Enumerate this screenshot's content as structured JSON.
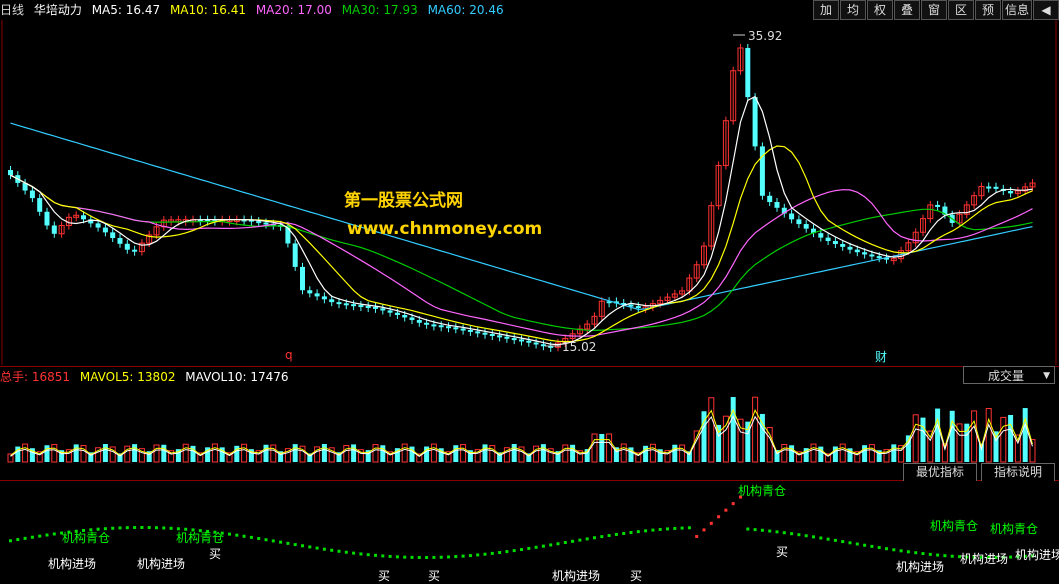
{
  "header": {
    "period": "日线",
    "stock_name": "华培动力",
    "ma_items": [
      {
        "label": "MA5: 16.47",
        "color": "#ffffff"
      },
      {
        "label": "MA10: 16.41",
        "color": "#ffff00"
      },
      {
        "label": "MA20: 17.00",
        "color": "#ff66ff"
      },
      {
        "label": "MA30: 17.93",
        "color": "#00cc00"
      },
      {
        "label": "MA60: 20.46",
        "color": "#33ccff"
      }
    ],
    "buttons": [
      "加",
      "均",
      "权",
      "叠",
      "窗",
      "区",
      "预",
      "信息",
      "◀"
    ]
  },
  "watermark": {
    "line1": "第一股票公式网",
    "line2": "www.chnmoney.com"
  },
  "price_labels": {
    "high": "35.92",
    "low": "15.02",
    "marker_q": "q",
    "marker_cai": "财"
  },
  "volume": {
    "title": "总手: 16851",
    "mavol5": "MAVOL5: 13802",
    "mavol10": "MAVOL10: 17476",
    "selector": "成交量"
  },
  "indicator": {
    "tabs": [
      "最优指标",
      "指标说明"
    ],
    "signals": [
      {
        "text": "机构青仓",
        "color": "#00ff00"
      },
      {
        "text": "机构进场",
        "color": "#ffffff"
      },
      {
        "text": "机构青仓",
        "color": "#00ff00"
      },
      {
        "text": "机构进场",
        "color": "#ffffff"
      },
      {
        "text": "买",
        "color": "#ffffff"
      },
      {
        "text": "买",
        "color": "#ffffff"
      },
      {
        "text": "买",
        "color": "#ffffff"
      },
      {
        "text": "机构进场",
        "color": "#ffffff"
      },
      {
        "text": "买",
        "color": "#ffffff"
      },
      {
        "text": "机构青仓",
        "color": "#00ff00"
      },
      {
        "text": "买",
        "color": "#ffffff"
      },
      {
        "text": "机构青仓",
        "color": "#00ff00"
      },
      {
        "text": "机构进场",
        "color": "#ffffff"
      },
      {
        "text": "机构进场",
        "color": "#ffffff"
      },
      {
        "text": "机构青仓",
        "color": "#00ff00"
      },
      {
        "text": "机构进场",
        "color": "#ffffff"
      }
    ]
  },
  "colors": {
    "up": "#ff3232",
    "down": "#54ffff",
    "grid": "#800000",
    "ma5": "#ffffff",
    "ma10": "#ffff00",
    "ma20": "#ff66ff",
    "ma30": "#00cc00",
    "ma60": "#33ccff"
  }
}
